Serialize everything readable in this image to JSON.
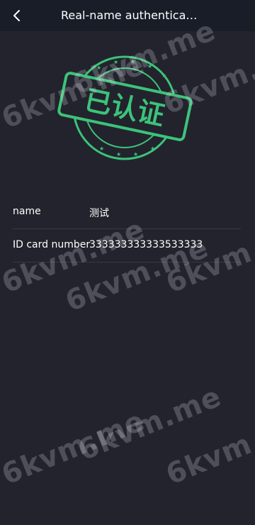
{
  "header": {
    "title": "Real-name authentication"
  },
  "stamp": {
    "text": "已认证",
    "color": "#3cc37a"
  },
  "info": {
    "rows": [
      {
        "label": "name",
        "value": "测试"
      },
      {
        "label": "ID card number",
        "value": "333333333333533333"
      }
    ]
  },
  "watermark": {
    "text": "6kvm.me"
  },
  "icons": {
    "back": "chevron-left-icon"
  },
  "colors": {
    "background": "#23232d",
    "header": "#181d28",
    "divider": "#3a3a45"
  }
}
